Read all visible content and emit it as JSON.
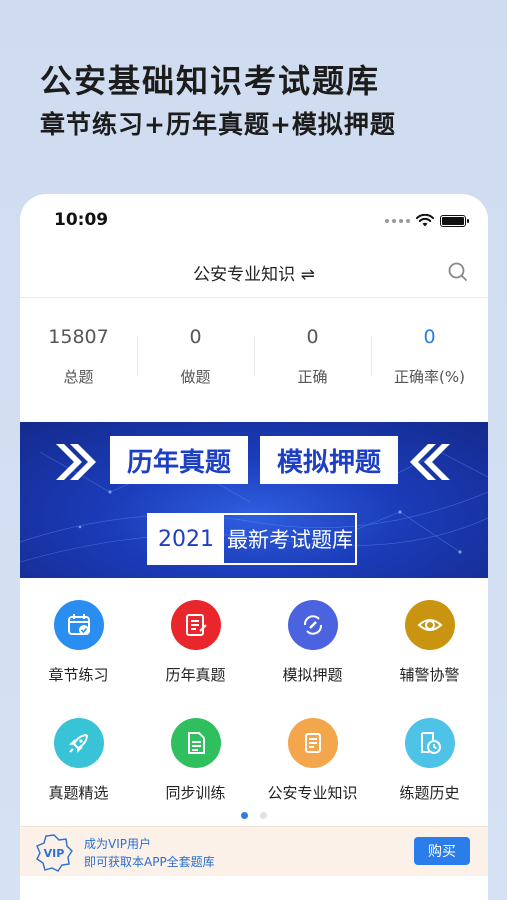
{
  "promo": {
    "title": "公安基础知识考试题库",
    "subtitle": "章节练习+历年真题+模拟押题"
  },
  "status_bar": {
    "time": "10:09"
  },
  "nav": {
    "title": "公安专业知识 ⇌",
    "search_icon": "search-icon"
  },
  "stats": [
    {
      "value": "15807",
      "label": "总题"
    },
    {
      "value": "0",
      "label": "做题"
    },
    {
      "value": "0",
      "label": "正确"
    },
    {
      "value": "0",
      "label": "正确率(%)"
    }
  ],
  "banner": {
    "tag1": "历年真题",
    "tag2": "模拟押题",
    "year": "2021",
    "caption": "最新考试题库"
  },
  "menu": [
    {
      "label": "章节练习",
      "icon": "calendar-check-icon",
      "color": "#2a8df0"
    },
    {
      "label": "历年真题",
      "icon": "document-list-icon",
      "color": "#e8262b"
    },
    {
      "label": "模拟押题",
      "icon": "refresh-edit-icon",
      "color": "#4c63e0"
    },
    {
      "label": "辅警协警",
      "icon": "eye-icon",
      "color": "#c9940f"
    },
    {
      "label": "真题精选",
      "icon": "rocket-icon",
      "color": "#38c4d6"
    },
    {
      "label": "同步训练",
      "icon": "document-icon",
      "color": "#2fbf5e"
    },
    {
      "label": "公安专业知识",
      "icon": "scroll-icon",
      "color": "#f3a64b"
    },
    {
      "label": "练题历史",
      "icon": "history-document-icon",
      "color": "#4fc2e8"
    }
  ],
  "pager": {
    "total": 2,
    "active": 0
  },
  "vip": {
    "badge_text": "VIP",
    "line1": "成为VIP用户",
    "line2": "即可获取本APP全套题库",
    "button": "购买"
  }
}
